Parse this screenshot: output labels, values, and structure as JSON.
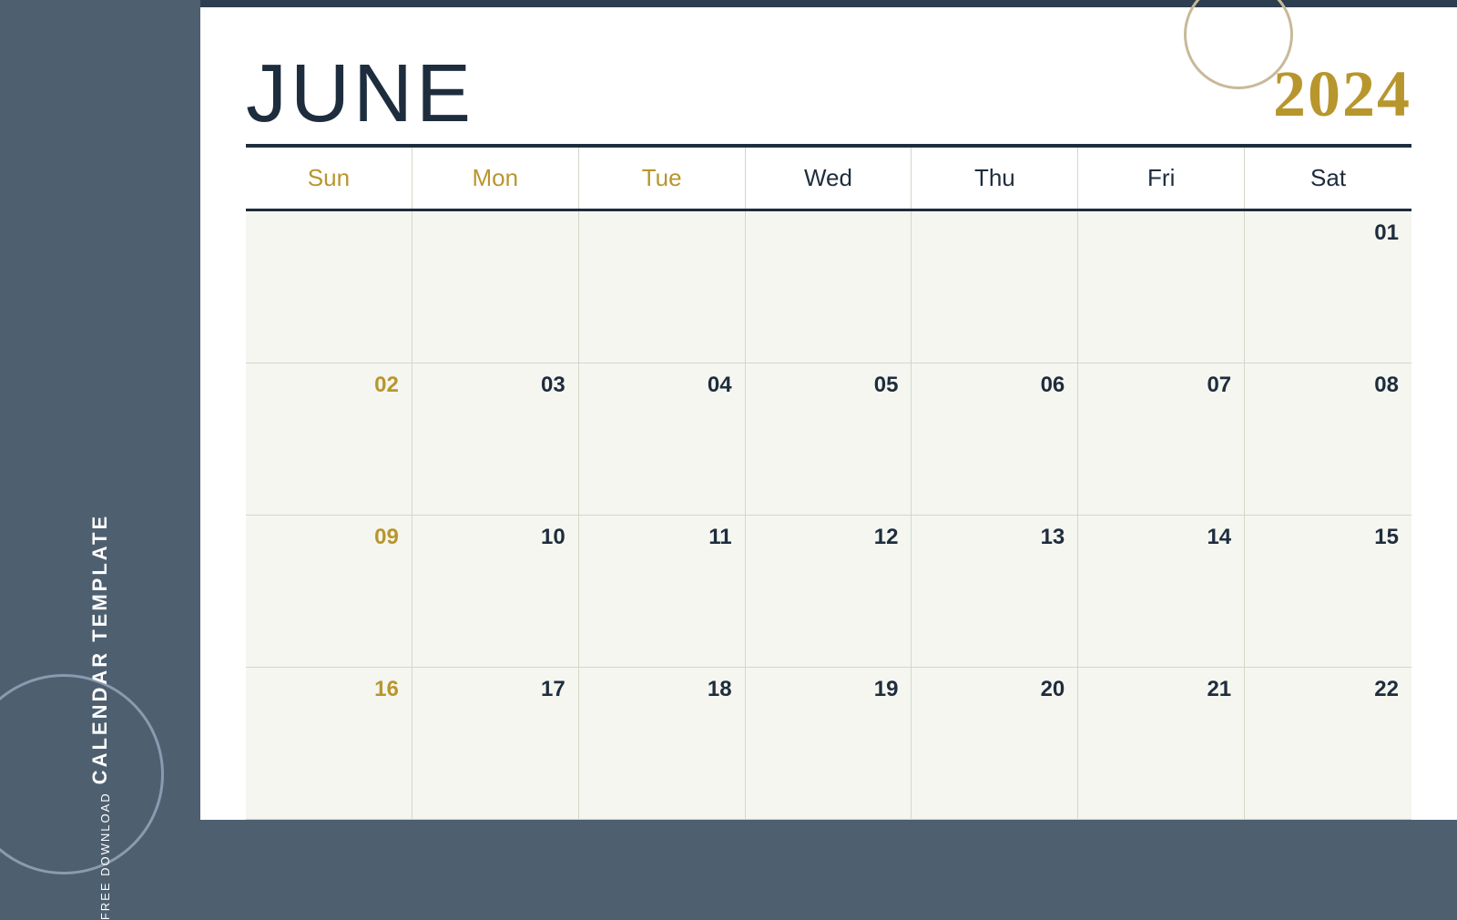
{
  "sidebar": {
    "free_download_label": "FREE DOWNLOAD",
    "calendar_template_label": "CALENDAR TEMPLATE"
  },
  "calendar": {
    "month": "JUNE",
    "year": "2024",
    "day_headers": [
      "Sun",
      "Mon",
      "Tue",
      "Wed",
      "Thu",
      "Fri",
      "Sat"
    ],
    "weeks": [
      [
        {
          "number": "",
          "empty": true
        },
        {
          "number": "",
          "empty": true
        },
        {
          "number": "",
          "empty": true
        },
        {
          "number": "",
          "empty": true
        },
        {
          "number": "",
          "empty": true
        },
        {
          "number": "",
          "empty": true
        },
        {
          "number": "01",
          "color": "dark"
        }
      ],
      [
        {
          "number": "02",
          "color": "gold"
        },
        {
          "number": "03",
          "color": "dark"
        },
        {
          "number": "04",
          "color": "dark"
        },
        {
          "number": "05",
          "color": "dark"
        },
        {
          "number": "06",
          "color": "dark"
        },
        {
          "number": "07",
          "color": "dark"
        },
        {
          "number": "08",
          "color": "dark"
        }
      ],
      [
        {
          "number": "09",
          "color": "gold"
        },
        {
          "number": "10",
          "color": "dark"
        },
        {
          "number": "11",
          "color": "dark"
        },
        {
          "number": "12",
          "color": "dark"
        },
        {
          "number": "13",
          "color": "dark"
        },
        {
          "number": "14",
          "color": "dark"
        },
        {
          "number": "15",
          "color": "dark"
        }
      ],
      [
        {
          "number": "16",
          "color": "gold"
        },
        {
          "number": "17",
          "color": "dark"
        },
        {
          "number": "18",
          "color": "dark"
        },
        {
          "number": "19",
          "color": "dark"
        },
        {
          "number": "20",
          "color": "dark"
        },
        {
          "number": "21",
          "color": "dark"
        },
        {
          "number": "22",
          "color": "dark"
        }
      ]
    ]
  }
}
